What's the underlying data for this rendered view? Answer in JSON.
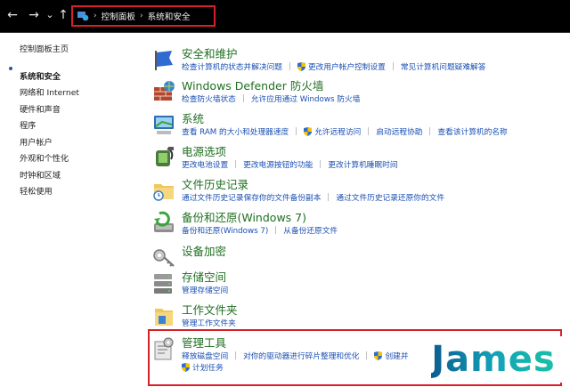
{
  "nav": {
    "back": "←",
    "forward": "→",
    "history": "⌄",
    "up": "↑"
  },
  "breadcrumb": {
    "root": "控制面板",
    "current": "系统和安全"
  },
  "sidebar": {
    "home": "控制面板主页",
    "items": [
      "系统和安全",
      "网络和 Internet",
      "硬件和声音",
      "程序",
      "用户帐户",
      "外观和个性化",
      "时钟和区域",
      "轻松使用"
    ]
  },
  "categories": [
    {
      "title": "安全和维护",
      "links": [
        "检查计算机的状态并解决问题",
        "更改用户帐户控制设置",
        "常见计算机问题疑难解答"
      ]
    },
    {
      "title": "Windows Defender 防火墙",
      "links": [
        "检查防火墙状态",
        "允许应用通过 Windows 防火墙"
      ]
    },
    {
      "title": "系统",
      "links": [
        "查看 RAM 的大小和处理器速度",
        "允许远程访问",
        "启动远程协助",
        "查看该计算机的名称"
      ]
    },
    {
      "title": "电源选项",
      "links": [
        "更改电池设置",
        "更改电源按钮的功能",
        "更改计算机睡眠时间"
      ]
    },
    {
      "title": "文件历史记录",
      "links": [
        "通过文件历史记录保存你的文件备份副本",
        "通过文件历史记录还原你的文件"
      ]
    },
    {
      "title": "备份和还原(Windows 7)",
      "links": [
        "备份和还原(Windows 7)",
        "从备份还原文件"
      ]
    },
    {
      "title": "设备加密",
      "links": []
    },
    {
      "title": "存储空间",
      "links": [
        "管理存储空间"
      ]
    },
    {
      "title": "工作文件夹",
      "links": [
        "管理工作文件夹"
      ]
    },
    {
      "title": "管理工具",
      "links": [
        "释放磁盘空间",
        "对你的驱动器进行碎片整理和优化",
        "创建并"
      ],
      "extra": "计划任务"
    }
  ],
  "watermark": "James",
  "colors": {
    "title_green": "#1f6f21",
    "link_blue": "#1a4fb3",
    "highlight_red": "#d8202a"
  }
}
